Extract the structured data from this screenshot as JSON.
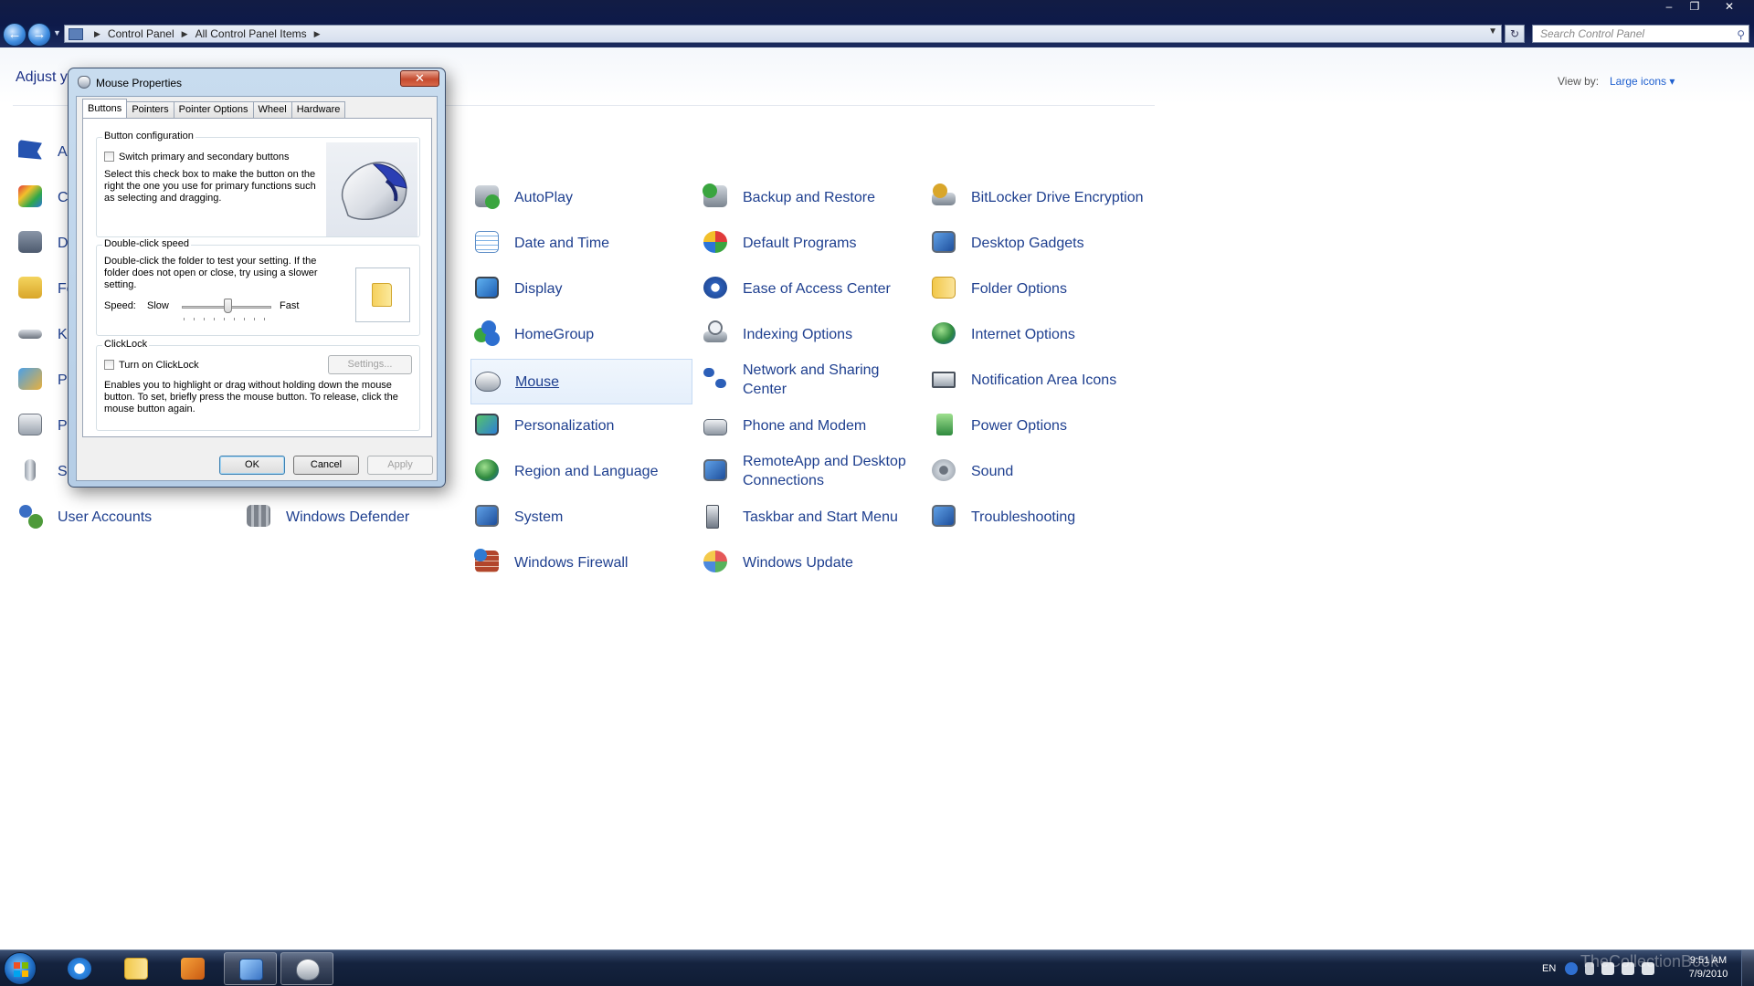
{
  "window": {
    "title_bar_buttons": [
      "minimize",
      "restore",
      "close"
    ]
  },
  "address_bar": {
    "crumbs": [
      "Control Panel",
      "All Control Panel Items"
    ],
    "search_placeholder": "Search Control Panel"
  },
  "control_panel": {
    "title": "Adjust y",
    "view_by_label": "View by:",
    "view_by_value": "Large icons",
    "items": [
      {
        "label": "Ac",
        "icon": "action-center-flag-icon"
      },
      {
        "label": "Co",
        "icon": "color-management-icon"
      },
      {
        "label": "De",
        "icon": "devices-icon"
      },
      {
        "label": "Fo",
        "icon": "fonts-icon"
      },
      {
        "label": "Ke",
        "icon": "keyboard-icon"
      },
      {
        "label": "Pa",
        "icon": "parental-controls-icon"
      },
      {
        "label": "Pr",
        "icon": "programs-icon"
      },
      {
        "label": "Sp",
        "icon": "microphone-icon"
      },
      {
        "label": "User Accounts",
        "icon": "user-accounts-icon"
      },
      {
        "label": "Windows Defender",
        "icon": "windows-defender-icon"
      },
      {
        "label": "AutoPlay",
        "icon": "autoplay-icon"
      },
      {
        "label": "Date and Time",
        "icon": "date-time-icon"
      },
      {
        "label": "Display",
        "icon": "display-icon"
      },
      {
        "label": "HomeGroup",
        "icon": "homegroup-icon"
      },
      {
        "label": "Mouse",
        "icon": "mouse-icon"
      },
      {
        "label": "Personalization",
        "icon": "personalization-icon"
      },
      {
        "label": "Region and Language",
        "icon": "region-globe-icon"
      },
      {
        "label": "System",
        "icon": "system-icon"
      },
      {
        "label": "Windows Firewall",
        "icon": "firewall-icon"
      },
      {
        "label": "Backup and Restore",
        "icon": "backup-icon"
      },
      {
        "label": "Default Programs",
        "icon": "default-programs-icon"
      },
      {
        "label": "Ease of Access Center",
        "icon": "ease-of-access-icon"
      },
      {
        "label": "Indexing Options",
        "icon": "indexing-icon"
      },
      {
        "label": "Network and Sharing Center",
        "icon": "network-icon"
      },
      {
        "label": "Phone and Modem",
        "icon": "phone-icon"
      },
      {
        "label": "RemoteApp and Desktop Connections",
        "icon": "remoteapp-icon"
      },
      {
        "label": "Taskbar and Start Menu",
        "icon": "taskbar-icon"
      },
      {
        "label": "Windows Update",
        "icon": "windows-update-icon"
      },
      {
        "label": "BitLocker Drive Encryption",
        "icon": "bitlocker-icon"
      },
      {
        "label": "Desktop Gadgets",
        "icon": "gadgets-icon"
      },
      {
        "label": "Folder Options",
        "icon": "folder-options-icon"
      },
      {
        "label": "Internet Options",
        "icon": "internet-options-icon"
      },
      {
        "label": "Notification Area Icons",
        "icon": "notification-icon"
      },
      {
        "label": "Power Options",
        "icon": "power-icon"
      },
      {
        "label": "Sound",
        "icon": "sound-icon"
      },
      {
        "label": "Troubleshooting",
        "icon": "troubleshooting-icon"
      }
    ],
    "selected_item": "Mouse"
  },
  "dialog": {
    "title": "Mouse Properties",
    "tabs": [
      "Buttons",
      "Pointers",
      "Pointer Options",
      "Wheel",
      "Hardware"
    ],
    "active_tab": "Buttons",
    "button_config": {
      "legend": "Button configuration",
      "checkbox_label": "Switch primary and secondary buttons",
      "checked": false,
      "description_lines": [
        "Select this check box to make the button on the",
        "right the one you use for primary functions such",
        "as selecting and dragging."
      ]
    },
    "double_click": {
      "legend": "Double-click speed",
      "description_lines": [
        "Double-click the folder to test your setting. If the",
        "folder does not open or close, try using a slower",
        "setting."
      ],
      "speed_label": "Speed:",
      "slow_label": "Slow",
      "fast_label": "Fast",
      "speed_fraction": 0.5
    },
    "clicklock": {
      "legend": "ClickLock",
      "checkbox_label": "Turn on ClickLock",
      "checked": false,
      "settings_button": "Settings...",
      "description_lines": [
        "Enables you to highlight or drag without holding down the mouse",
        "button. To set, briefly press the mouse button. To release, click the",
        "mouse button again."
      ]
    },
    "buttons": {
      "ok": "OK",
      "cancel": "Cancel",
      "apply": "Apply"
    }
  },
  "taskbar": {
    "pinned": [
      "internet-explorer-icon",
      "explorer-folder-icon",
      "media-player-icon",
      "control-panel-icon",
      "mouse-properties-icon"
    ],
    "tray_lang": "EN",
    "clock_time": "9:51 AM",
    "clock_date": "7/9/2010"
  },
  "watermark": "TheCollectionBook",
  "colors": {
    "link": "#1e3f8f",
    "selection": "#e5effb",
    "taskbar": "#15233f"
  }
}
